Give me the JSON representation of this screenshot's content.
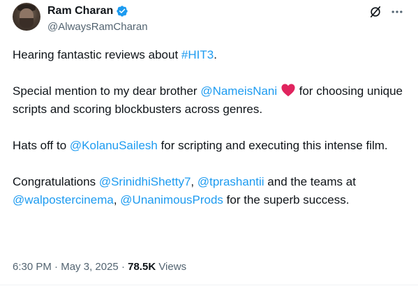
{
  "author": {
    "display_name": "Ram Charan",
    "handle": "@AlwaysRamCharan",
    "verified": true
  },
  "icons": {
    "verified": "verified-badge-icon",
    "grok": "grok-icon",
    "more": "more-icon",
    "heart": "red-heart-emoji"
  },
  "colors": {
    "link": "#1d9bf0",
    "verified": "#1d9bf0",
    "heart": "#e0245e",
    "secondary_text": "#536471"
  },
  "post": {
    "p1": {
      "t1": "Hearing fantastic reviews about ",
      "tag": "#HIT3",
      "t2": "."
    },
    "p2": {
      "t1": "Special mention to my dear brother ",
      "mention": "@NameisNani",
      "t2": " for choosing unique scripts and scoring blockbusters across genres."
    },
    "p3": {
      "t1": "Hats off to ",
      "mention": "@KolanuSailesh",
      "t2": " for scripting and executing this intense film."
    },
    "p4": {
      "t1": "Congratulations ",
      "m1": "@SrinidhiShetty7",
      "t2": ", ",
      "m2": "@tprashantii",
      "t3": " and the teams at ",
      "m3": "@walpostercinema",
      "t4": ", ",
      "m4": "@UnanimousProds",
      "t5": " for the superb success."
    }
  },
  "meta": {
    "time": "6:30 PM",
    "separator": " · ",
    "date": "May 3, 2025",
    "views_count": "78.5K",
    "views_label": " Views"
  }
}
